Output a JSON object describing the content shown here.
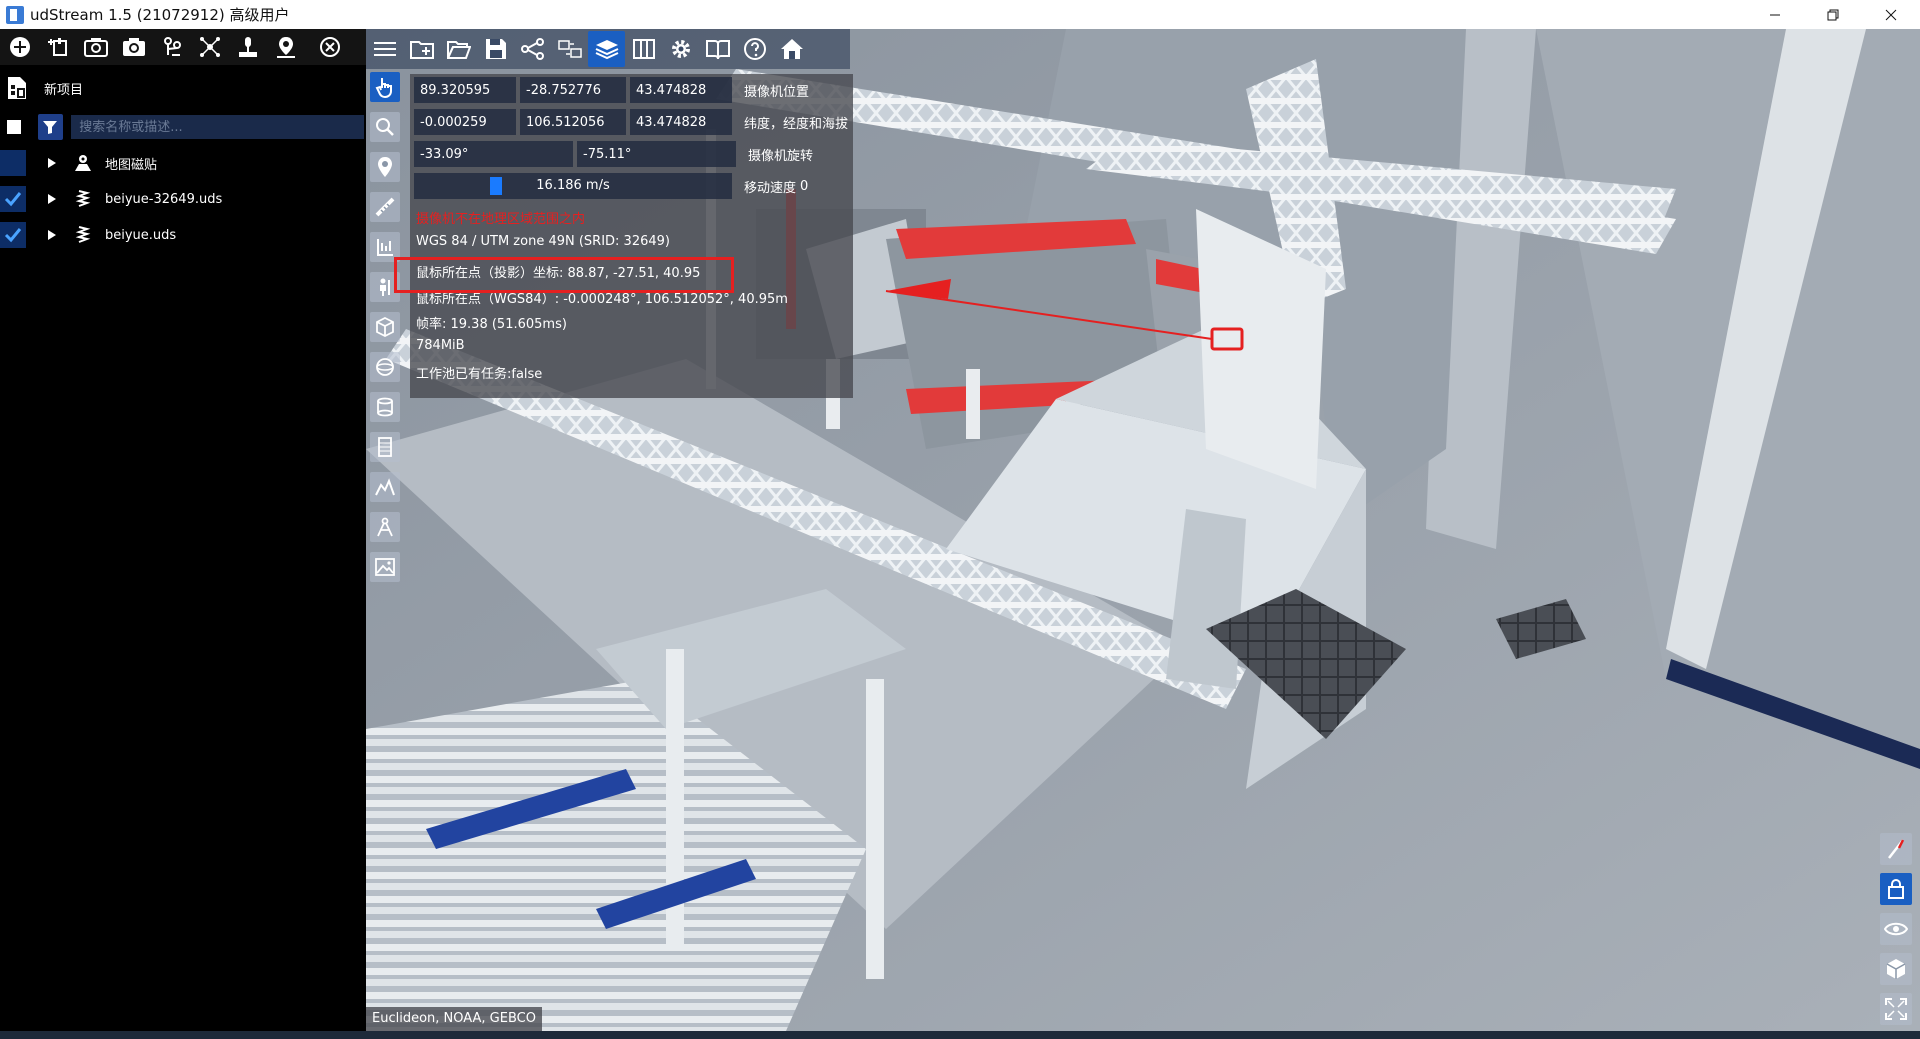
{
  "window": {
    "title": "udStream 1.5 (21072912) 高级用户"
  },
  "left_panel": {
    "toolbar_icons": [
      "add-icon",
      "add-layer-icon",
      "screenshot-icon",
      "camera-icon",
      "flythrough-icon",
      "network-icon",
      "place-pin-icon",
      "location-icon",
      "close-circle-icon"
    ],
    "project_label": "新项目",
    "search_placeholder": "搜索名称或描述...",
    "items": [
      {
        "label": "地图磁贴",
        "checked": false,
        "icon": "map-tiles-icon"
      },
      {
        "label": "beiyue-32649.uds",
        "checked": true,
        "icon": "pointcloud-icon"
      },
      {
        "label": "beiyue.uds",
        "checked": true,
        "icon": "pointcloud-icon"
      }
    ]
  },
  "info_panel": {
    "camera_position": [
      "89.320595",
      "-28.752776",
      "43.474828"
    ],
    "camera_position_label": "摄像机位置",
    "lat_lon_alt": [
      "-0.000259",
      "106.512056",
      "43.474828"
    ],
    "lat_lon_alt_label": "纬度，经度和海拔",
    "camera_rotation": [
      "-33.09°",
      "-75.11°"
    ],
    "camera_rotation_label": "摄像机旋转",
    "move_speed": "16.186 m/s",
    "move_speed_label": "移动速度",
    "move_speed_suffix": "0",
    "warning": "摄像机不在地理区域范围之内",
    "srid": "WGS 84 / UTM zone 49N (SRID: 32649)",
    "mouse_projected": "鼠标所在点（投影）坐标: 88.87, -27.51, 40.95",
    "mouse_wgs84": "鼠标所在点（WGS84）: -0.000248°, 106.512052°, 40.95m",
    "fps": "帧率: 19.38 (51.605ms)",
    "memory": "784MiB",
    "worker_pool": "工作池已有任务:false"
  },
  "viewport": {
    "attribution": "Euclideon, NOAA, GEBCO"
  },
  "colors": {
    "accent": "#1a5fc2",
    "annotation": "#e52020"
  }
}
